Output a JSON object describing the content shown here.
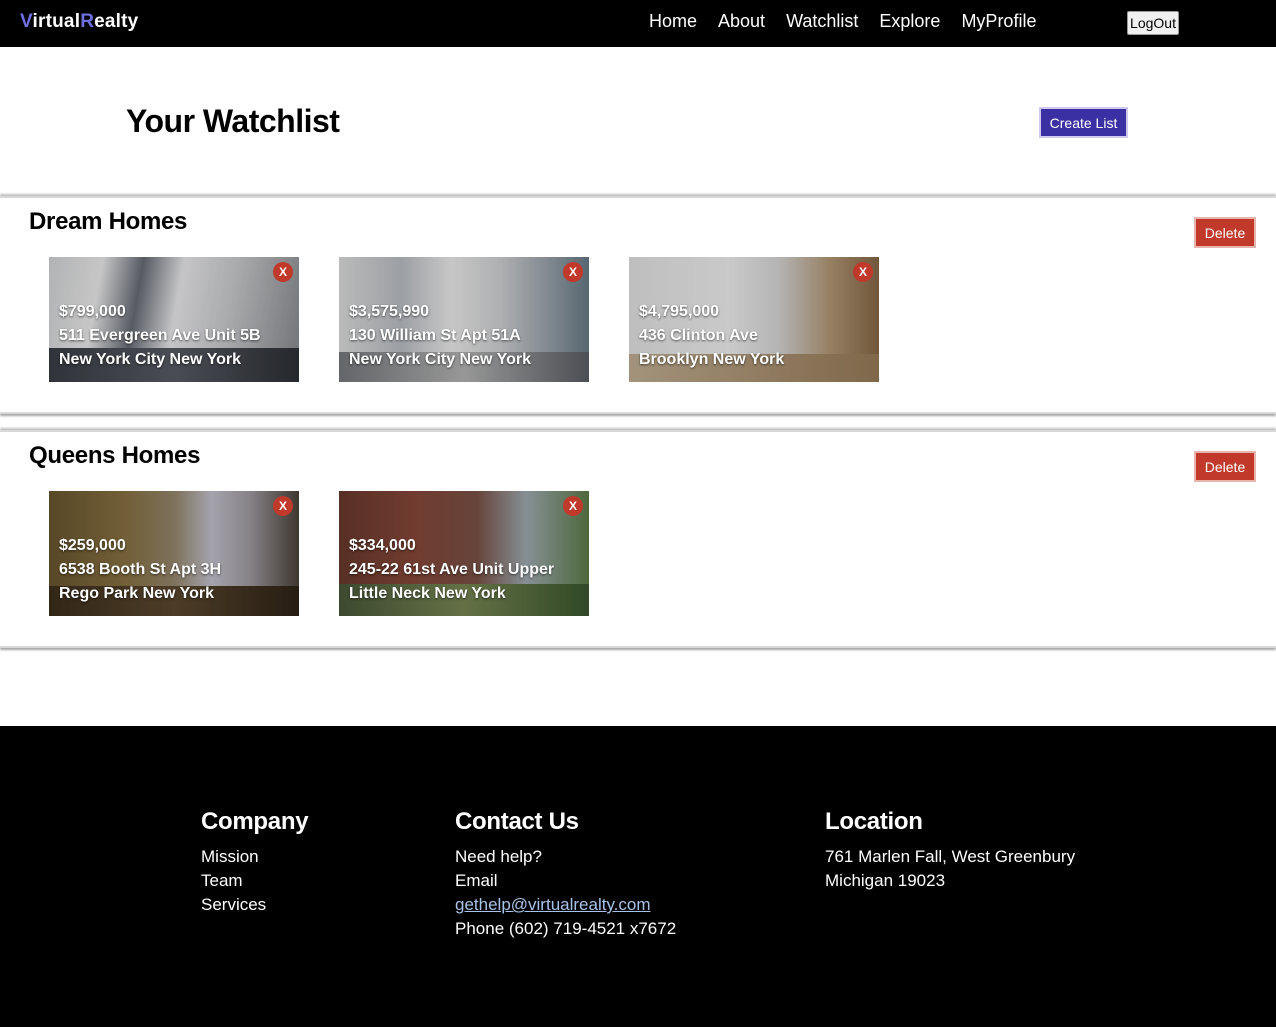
{
  "navbar": {
    "logo": {
      "v": "V",
      "irtual": "irtual",
      "r": "R",
      "ealty": "ealty"
    },
    "links": [
      "Home",
      "About",
      "Watchlist",
      "Explore",
      "MyProfile"
    ],
    "logout": "LogOut"
  },
  "header": {
    "title": "Your Watchlist",
    "create_button": "Create List"
  },
  "lists": [
    {
      "name": "Dream Homes",
      "delete_label": "Delete",
      "cards": [
        {
          "price": "$799,000",
          "address": "511 Evergreen Ave Unit 5B",
          "city": "New York City New York",
          "remove": "X"
        },
        {
          "price": "$3,575,990",
          "address": "130 William St Apt 51A",
          "city": "New York City New York",
          "remove": "X"
        },
        {
          "price": "$4,795,000",
          "address": "436 Clinton Ave",
          "city": "Brooklyn New York",
          "remove": "X"
        }
      ]
    },
    {
      "name": "Queens Homes",
      "delete_label": "Delete",
      "cards": [
        {
          "price": "$259,000",
          "address": "6538 Booth St Apt 3H",
          "city": "Rego Park New York",
          "remove": "X"
        },
        {
          "price": "$334,000",
          "address": "245-22 61st Ave Unit Upper",
          "city": "Little Neck New York",
          "remove": "X"
        }
      ]
    }
  ],
  "footer": {
    "company": {
      "heading": "Company",
      "items": [
        "Mission",
        "Team",
        "Services"
      ]
    },
    "contact": {
      "heading": "Contact Us",
      "need_help": "Need help?",
      "email_label": "Email",
      "email": "gethelp@virtualrealty.com",
      "phone": "Phone (602) 719-4521 x7672"
    },
    "location": {
      "heading": "Location",
      "line1": "761 Marlen Fall, West Greenbury",
      "line2": "Michigan 19023"
    }
  },
  "colors": {
    "brand_accent": "#6f6fe0",
    "primary_button": "#3a2fa3",
    "danger": "#c0392b",
    "footer_link": "#a9c3e6"
  }
}
